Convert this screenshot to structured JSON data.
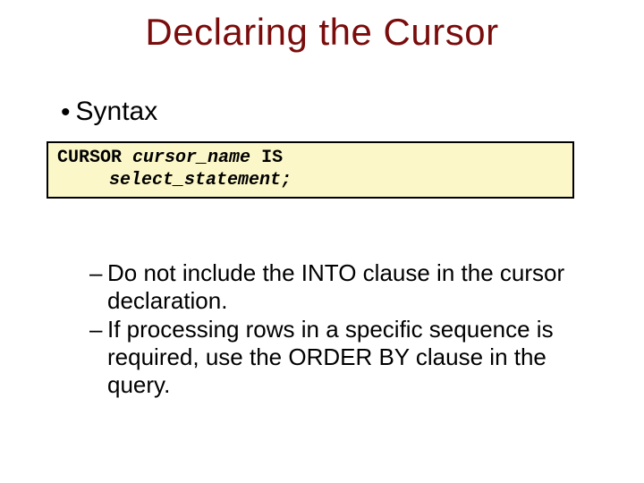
{
  "title": "Declaring the Cursor",
  "bullet_main": "Syntax",
  "code": {
    "kw_cursor": "CURSOR",
    "cursor_name": "cursor_name",
    "kw_is": "IS",
    "select_stmt": "select_statement;"
  },
  "notes": [
    "Do not include the INTO clause in the cursor declaration.",
    "If processing rows in a specific sequence is required, use the ORDER BY clause in the query."
  ]
}
